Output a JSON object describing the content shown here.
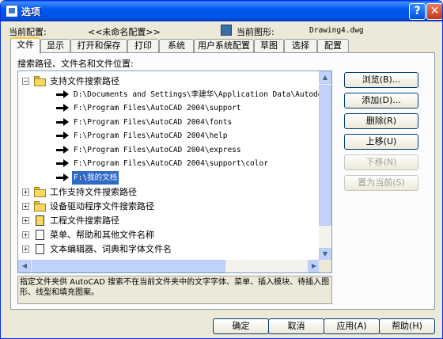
{
  "window": {
    "title": "选项",
    "help_glyph": "?",
    "close_glyph": "✕"
  },
  "profile": {
    "label": "当前配置:",
    "value": "<<未命名配置>>"
  },
  "drawing": {
    "label": "当前图形:",
    "value": "Drawing4.dwg"
  },
  "tabs": [
    {
      "label": "文件"
    },
    {
      "label": "显示"
    },
    {
      "label": "打开和保存"
    },
    {
      "label": "打印"
    },
    {
      "label": "系统"
    },
    {
      "label": "用户系统配置"
    },
    {
      "label": "草图"
    },
    {
      "label": "选择"
    },
    {
      "label": "配置"
    }
  ],
  "files": {
    "section_label": "搜索路径、文件名和文件位置:",
    "tree": {
      "root": {
        "label": "支持文件搜索路径",
        "expander": "−"
      },
      "paths": [
        "D:\\Documents and Settings\\李建华\\Application Data\\Autodesk\\A",
        "F:\\Program Files\\AutoCAD 2004\\support",
        "F:\\Program Files\\AutoCAD 2004\\fonts",
        "F:\\Program Files\\AutoCAD 2004\\help",
        "F:\\Program Files\\AutoCAD 2004\\express",
        "F:\\Program Files\\AutoCAD 2004\\support\\color",
        "F:\\我的文档"
      ],
      "selected_path_index": 6,
      "nodes": [
        {
          "label": "工作支持文件搜索路径",
          "expander": "+"
        },
        {
          "label": "设备驱动程序文件搜索路径",
          "expander": "+"
        },
        {
          "label": "工程文件搜索路径",
          "expander": "+"
        },
        {
          "label": "菜单、帮助和其他文件名称",
          "expander": "+"
        },
        {
          "label": "文本编辑器、词典和字体文件名",
          "expander": "+"
        }
      ]
    },
    "buttons": {
      "browse": "浏览(B)...",
      "add": "添加(D)...",
      "remove": "删除(R)",
      "move_up": "上移(U)",
      "move_down": "下移(N)",
      "set_current": "置为当前(S)"
    },
    "description": "指定文件夹供 AutoCAD 搜索不在当前文件夹中的文字字体、菜单、插入模块、待插入图形、线型和填充图案。"
  },
  "footer": {
    "ok": "确定",
    "cancel": "取消",
    "apply": "应用(A)",
    "help": "帮助(H)"
  },
  "scrollbar_glyphs": {
    "up": "▲",
    "down": "▼",
    "left": "◀",
    "right": "▶"
  },
  "colors": {
    "titlebar": "#0058ee",
    "selection": "#316ac5",
    "window_bg": "#ece9d8",
    "active_tab_accent": "#ffc83c"
  }
}
